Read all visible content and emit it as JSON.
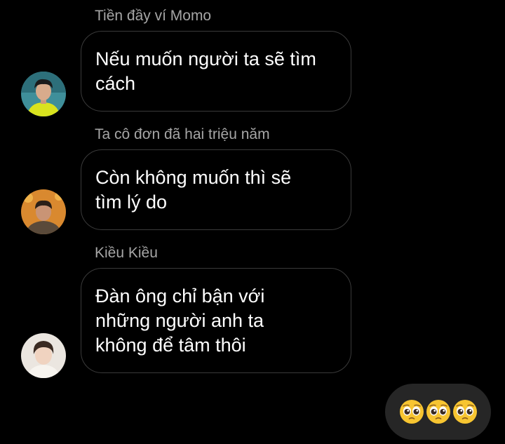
{
  "messages": [
    {
      "sender": "Tiền đầy ví Momo",
      "text": "Nếu muốn người ta sẽ tìm\ncách",
      "avatar": "avatar-yellow-shirt"
    },
    {
      "sender": "Ta cô đơn đã hai triệu năm",
      "text": "Còn không muốn thì sẽ\ntìm lý do",
      "avatar": "avatar-orange-background"
    },
    {
      "sender": "Kiều Kiều",
      "text": "Đàn ông chỉ bận với\nnhững người anh ta\nkhông để tâm thôi",
      "avatar": "avatar-light-background"
    }
  ],
  "my_message": {
    "emojis": [
      "pleading-face-icon",
      "pleading-face-icon",
      "pleading-face-icon"
    ]
  },
  "colors": {
    "background": "#000000",
    "sender_name": "#a6a6a6",
    "bubble_border": "#3a3a3a",
    "my_bubble": "#262626",
    "emoji_yellow": "#f7c531"
  }
}
